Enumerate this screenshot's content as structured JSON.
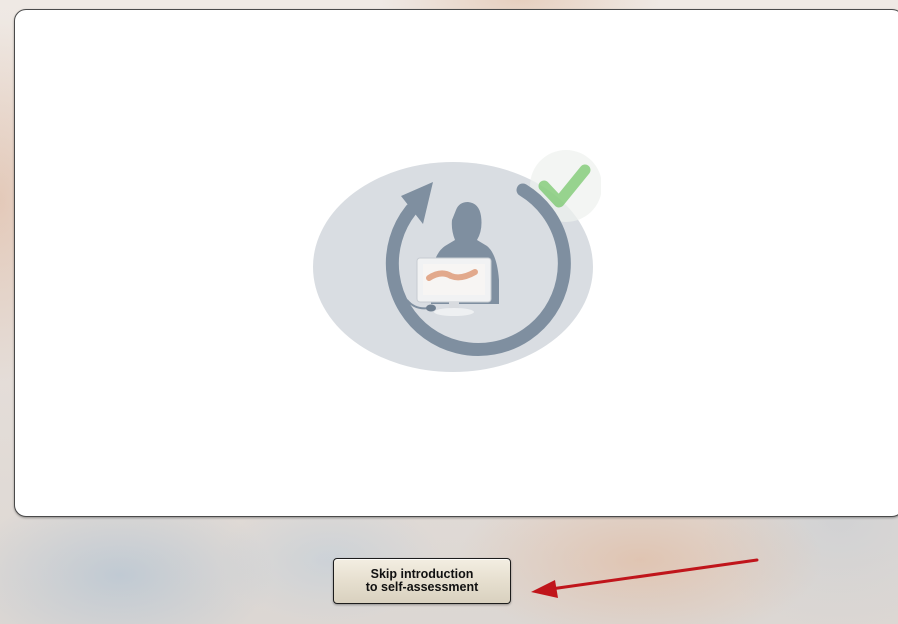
{
  "skip_button": {
    "line1": "Skip introduction",
    "line2": "to self-assessment"
  },
  "loader": {
    "icons": [
      "circular-arrow-icon",
      "user-at-computer-icon",
      "checkmark-icon"
    ],
    "colors": {
      "disc": "#d9dde2",
      "figure": "#8796a4",
      "checkmark": "#7cc472",
      "annotation_arrow": "#c0151b"
    }
  }
}
